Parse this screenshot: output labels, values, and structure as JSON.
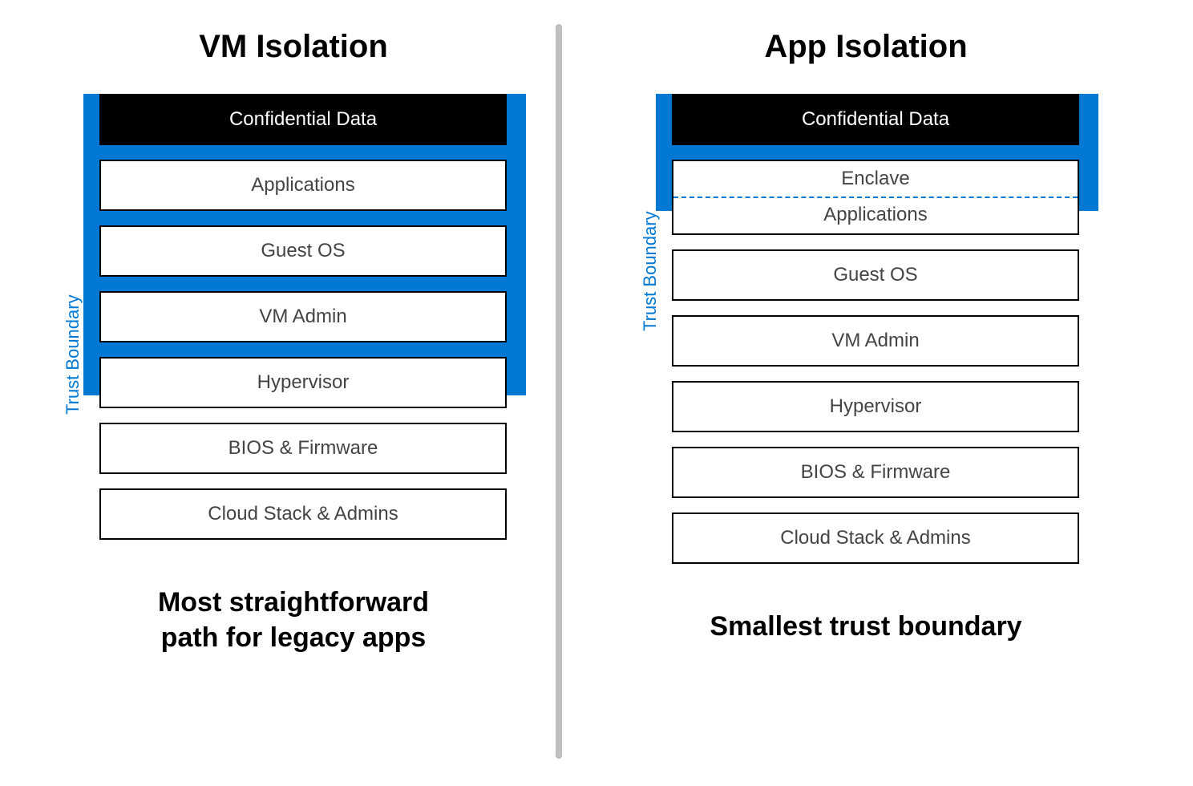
{
  "trust_boundary_label": "Trust Boundary",
  "left": {
    "title": "VM Isolation",
    "layers": {
      "confidential": "Confidential Data",
      "applications": "Applications",
      "guest_os": "Guest OS",
      "vm_admin": "VM Admin",
      "hypervisor": "Hypervisor",
      "bios": "BIOS & Firmware",
      "cloud": "Cloud Stack & Admins"
    },
    "caption_line1": "Most straightforward",
    "caption_line2": "path for legacy apps"
  },
  "right": {
    "title": "App Isolation",
    "layers": {
      "confidential": "Confidential Data",
      "enclave": "Enclave",
      "applications": "Applications",
      "guest_os": "Guest OS",
      "vm_admin": "VM Admin",
      "hypervisor": "Hypervisor",
      "bios": "BIOS & Firmware",
      "cloud": "Cloud Stack & Admins"
    },
    "caption": "Smallest trust boundary"
  }
}
